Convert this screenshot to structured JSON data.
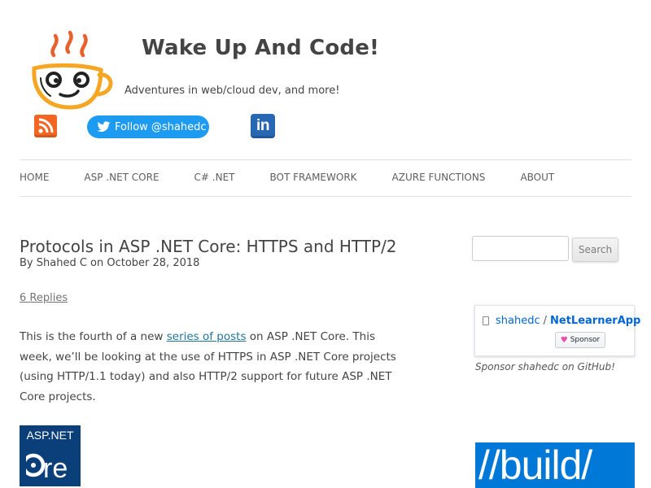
{
  "header": {
    "title": "Wake Up And Code!",
    "description": "Adventures in web/cloud dev, and more!",
    "twitter_label": "Follow @shahedc",
    "linkedin_label": "in"
  },
  "nav": {
    "items": [
      "HOME",
      "ASP .NET CORE",
      "C# .NET",
      "BOT FRAMEWORK",
      "AZURE FUNCTIONS",
      "ABOUT"
    ]
  },
  "post": {
    "title": "Protocols in ASP .NET Core: HTTPS and HTTP/2",
    "byline": "By Shahed C on October 28, 2018",
    "replies": "6 Replies",
    "intro_before": "This is the fourth of a new ",
    "intro_link": "series of posts",
    "intro_after": " on ASP .NET Core. This week, we’ll be looking at the use of HTTPS in ASP .NET Core projects (using HTTP/1.1 today) and also HTTP/2 support for future ASP .NET Core projects."
  },
  "aspnet_logo": {
    "line1": "ASP.NET",
    "line2": "Core"
  },
  "sidebar": {
    "search_placeholder": "",
    "search_button": "Search",
    "sponsor_owner": "shahedc",
    "sponsor_separator": "/",
    "sponsor_repo": "NetLearnerApp",
    "sponsor_button": "Sponsor",
    "sponsor_caption": "Sponsor shahedc on GitHub!",
    "build_text": "//build/"
  },
  "colors": {
    "accent_link": "#21759b",
    "twitter_blue": "#1d9bf0",
    "linkedin_blue": "#2867b2",
    "rss_orange": "#f26522",
    "build_blue": "#0078d7",
    "aspnet_navy": "#0b3f7a"
  }
}
